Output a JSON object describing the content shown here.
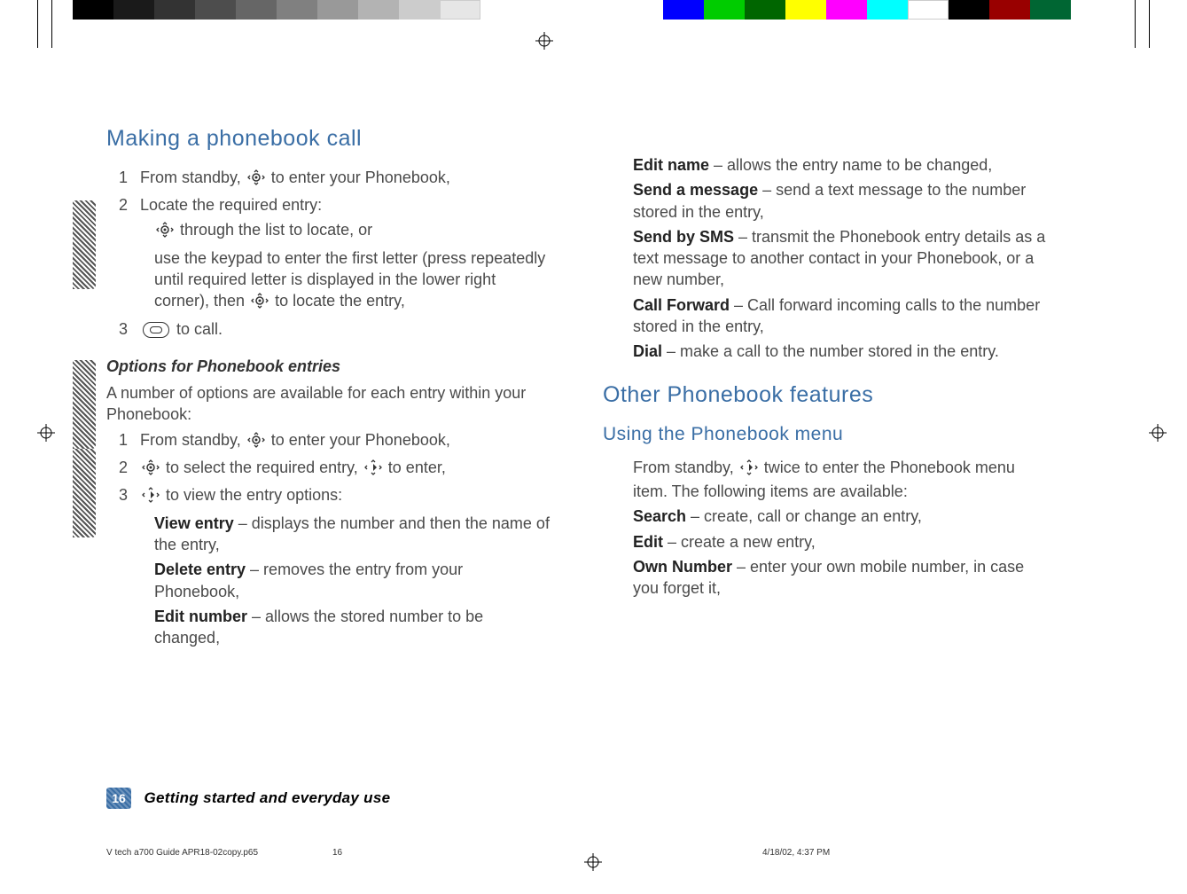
{
  "left": {
    "h1": "Making a phonebook call",
    "s1": {
      "n": "1",
      "a": "From standby, ",
      "b": " to enter your Phonebook,"
    },
    "s2": {
      "n": "2",
      "a": "Locate the required entry:"
    },
    "s2a": {
      "a": " through the list to locate, or"
    },
    "s2b": {
      "a": "use the keypad to enter the first letter (press repeatedly until required letter is displayed in the lower right corner), then ",
      "b": " to locate the entry,"
    },
    "s3": {
      "n": "3",
      "a": " to call."
    },
    "h3": "Options for Phonebook entries",
    "intro": "A number of options are available for each entry within your Phonebook:",
    "o1": {
      "n": "1",
      "a": "From standby, ",
      "b": " to enter your Phonebook,"
    },
    "o2": {
      "n": "2",
      "a": " to select the required entry, ",
      "b": " to enter,"
    },
    "o3": {
      "n": "3",
      "a": " to view the entry options:"
    },
    "opts": {
      "view": {
        "k": "View entry",
        "v": " – displays the number and then the name of the entry,"
      },
      "del": {
        "k": "Delete entry",
        "v": " – removes the entry from your Phonebook,"
      },
      "ednum": {
        "k": "Edit number",
        "v": " – allows the stored number to be changed,"
      }
    }
  },
  "right": {
    "opts": {
      "edname": {
        "k": "Edit name",
        "v": " – allows the entry name to be changed,"
      },
      "sendm": {
        "k": "Send a message",
        "v": " – send a text message to the number stored in the entry,"
      },
      "sms": {
        "k": "Send by SMS",
        "v": " – transmit the Phonebook entry details as a text message to another contact in your Phonebook, or a new number,"
      },
      "cf": {
        "k": "Call Forward",
        "v": " – Call forward incoming calls to the number stored in the entry,"
      },
      "dial": {
        "k": "Dial",
        "v": " – make a call to the number stored in the entry."
      }
    },
    "h1": "Other Phonebook features",
    "h2": "Using the Phonebook menu",
    "intro": {
      "a": "From standby, ",
      "b": " twice to enter the Phonebook menu item. The following items are available:"
    },
    "menu": {
      "search": {
        "k": "Search",
        "v": " – create, call or change an entry,"
      },
      "edit": {
        "k": "Edit",
        "v": " – create a new entry,"
      },
      "own": {
        "k": "Own Number",
        "v": " – enter your own mobile number, in case you forget it,"
      }
    }
  },
  "footer": {
    "page": "16",
    "chapter": "Getting started and everyday use"
  },
  "meta": {
    "file": "V tech a700 Guide APR18-02copy.p65",
    "page": "16",
    "date": "4/18/02, 4:37 PM"
  }
}
